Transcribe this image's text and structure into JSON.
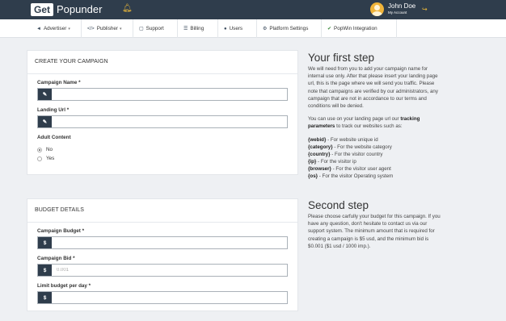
{
  "header": {
    "logo_get": "Get",
    "logo_rest": "Popunder",
    "user_name": "John Doe",
    "user_sub": "My Account"
  },
  "nav": [
    {
      "label": "Advertiser",
      "icon": "megaphone-icon",
      "dropdown": true
    },
    {
      "label": "Publisher",
      "icon": "code-icon",
      "dropdown": true
    },
    {
      "label": "Support",
      "icon": "chat-icon",
      "dropdown": false
    },
    {
      "label": "Billing",
      "icon": "billing-icon",
      "dropdown": false
    },
    {
      "label": "Users",
      "icon": "users-icon",
      "dropdown": false
    },
    {
      "label": "Platform Settings",
      "icon": "gears-icon",
      "dropdown": false
    },
    {
      "label": "PopWin Integration",
      "icon": "popwin-icon",
      "dropdown": false
    }
  ],
  "campaign": {
    "title": "CREATE YOUR CAMPAIGN",
    "name_label": "Campaign Name *",
    "name_value": "",
    "url_label": "Landing Url *",
    "url_value": "",
    "adult_label": "Adult Content",
    "adult_options": [
      "No",
      "Yes"
    ],
    "adult_selected": "No"
  },
  "budget": {
    "title": "BUDGET DETAILS",
    "budget_label": "Campaign Budget *",
    "budget_value": "",
    "bid_label": "Campaign Bid *",
    "bid_placeholder": "0.001",
    "limit_label": "Limit budget per day *",
    "limit_value": "",
    "currency": "$"
  },
  "info": {
    "first_title": "Your first step",
    "first_text": "We will need from you to add your campaign name for internal use only. After that please insert your landing page url, this is the page where we will send you traffic. Please note that campaigns are verified by our administrators, any campaign that are not in accordance to our terms and conditions will be denied.",
    "tracking_pre": "You can use on your landing page url our ",
    "tracking_bold": "tracking parameters",
    "tracking_post": " to track our websites such as:",
    "params": [
      {
        "key": "{webid}",
        "desc": " - For website unique id"
      },
      {
        "key": "{category}",
        "desc": " - For the website category"
      },
      {
        "key": "{country}",
        "desc": " - For the visitor country"
      },
      {
        "key": "{ip}",
        "desc": " - For the visitor ip"
      },
      {
        "key": "{browser}",
        "desc": " - For the visitor user agent"
      },
      {
        "key": "{os}",
        "desc": " - For the visitor Operating system"
      }
    ],
    "second_title": "Second step",
    "second_text": "Please choose carfully your budget for this campaign. If you have any question, don't hesitate to contact us via our support system. The minimum amount that is required for creating a campaign is $5 usd, and the minimum bid is $0.001 ($1 usd / 1000 imp.)."
  }
}
